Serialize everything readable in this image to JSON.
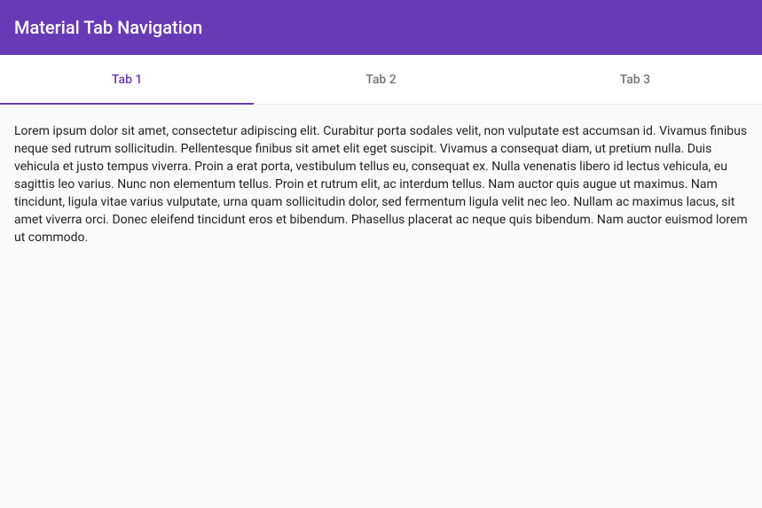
{
  "header": {
    "title": "Material Tab Navigation"
  },
  "tabs": {
    "items": [
      {
        "label": "Tab 1",
        "active": true
      },
      {
        "label": "Tab 2",
        "active": false
      },
      {
        "label": "Tab 3",
        "active": false
      }
    ]
  },
  "content": {
    "body": "Lorem ipsum dolor sit amet, consectetur adipiscing elit. Curabitur porta sodales velit, non vulputate est accumsan id. Vivamus finibus neque sed rutrum sollicitudin. Pellentesque finibus sit amet elit eget suscipit. Vivamus a consequat diam, ut pretium nulla. Duis vehicula et justo tempus viverra. Proin a erat porta, vestibulum tellus eu, consequat ex. Nulla venenatis libero id lectus vehicula, eu sagittis leo varius. Nunc non elementum tellus. Proin et rutrum elit, ac interdum tellus. Nam auctor quis augue ut maximus. Nam tincidunt, ligula vitae varius vulputate, urna quam sollicitudin dolor, sed fermentum ligula velit nec leo. Nullam ac maximus lacus, sit amet viverra orci. Donec eleifend tincidunt eros et bibendum. Phasellus placerat ac neque quis bibendum. Nam auctor euismod lorem ut commodo."
  }
}
